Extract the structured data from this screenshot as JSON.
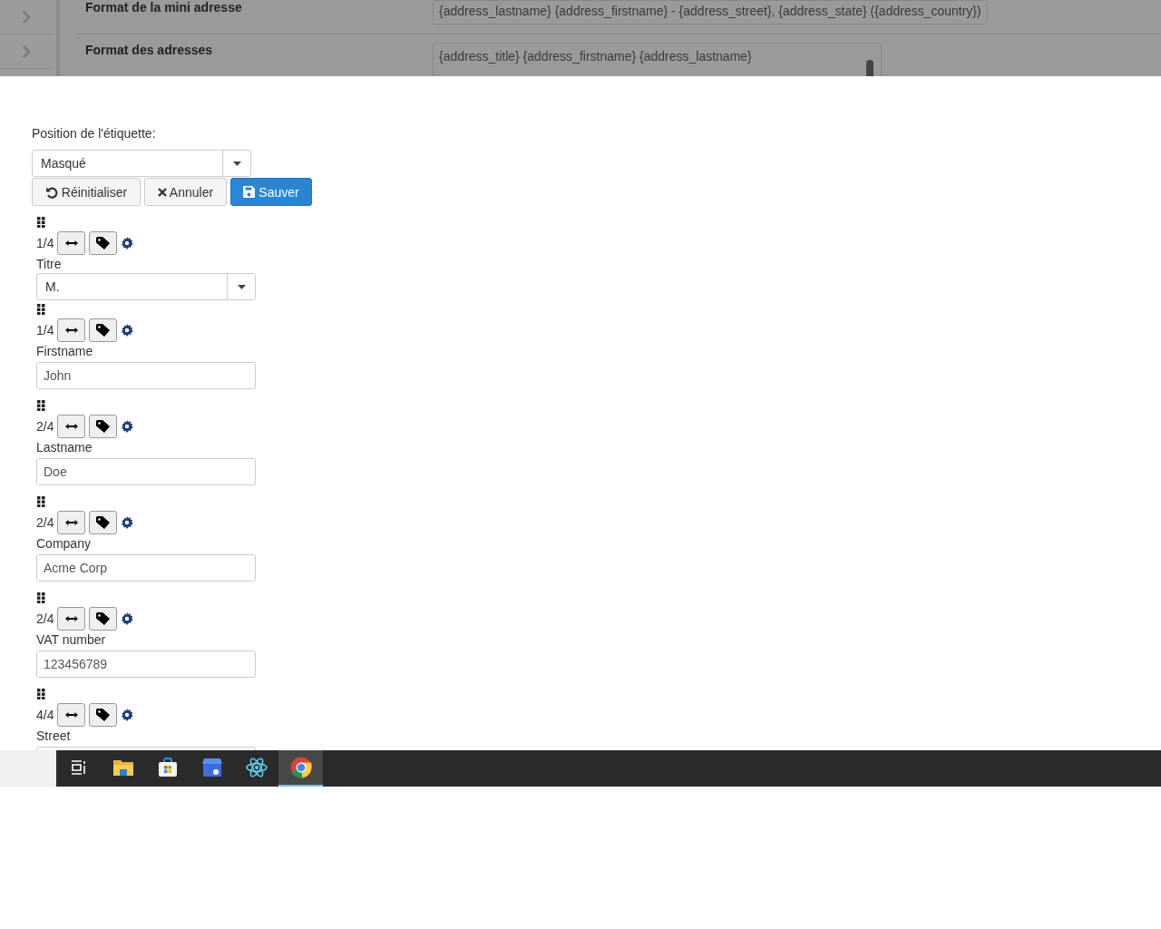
{
  "background": {
    "rows": [
      {
        "label": "Format de la mini adresse",
        "kind": "input",
        "lines": [
          "{address_lastname} {address_firstname} - {address_street}, {address_state} ({address_country})"
        ]
      },
      {
        "label": "Format des adresses",
        "kind": "textarea",
        "lines": [
          "{address_title} {address_firstname} {address_lastname}"
        ]
      }
    ]
  },
  "modal": {
    "label_position": {
      "label": "Position de l'étiquette:",
      "value": "Masqué"
    },
    "buttons": [
      {
        "label": "Réinitialiser",
        "kind": "reset"
      },
      {
        "label": "Annuler",
        "kind": "cancel"
      },
      {
        "label": "Sauver",
        "kind": "save"
      }
    ],
    "fields": [
      {
        "width": "1/4",
        "label": "Titre",
        "kind": "select",
        "value": "M."
      },
      {
        "width": "1/4",
        "label": "Firstname",
        "kind": "text",
        "value": "John"
      },
      {
        "width": "2/4",
        "label": "Lastname",
        "kind": "text",
        "value": "Doe"
      },
      {
        "width": "2/4",
        "label": "Company",
        "kind": "text",
        "value": "Acme Corp"
      },
      {
        "width": "2/4",
        "label": "VAT number",
        "kind": "text",
        "value": "123456789"
      },
      {
        "width": "4/4",
        "label": "Street",
        "kind": "text"
      }
    ]
  },
  "taskbar": {
    "apps": [
      {
        "kind": "taskview",
        "selected": false
      },
      {
        "kind": "files",
        "selected": false
      },
      {
        "kind": "store",
        "selected": false
      },
      {
        "kind": "business",
        "selected": false
      },
      {
        "kind": "atom",
        "selected": false
      },
      {
        "kind": "chrome",
        "selected": true
      }
    ]
  }
}
